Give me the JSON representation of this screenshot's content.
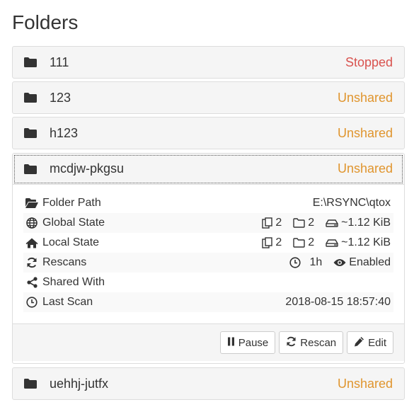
{
  "page": {
    "title": "Folders"
  },
  "colors": {
    "stopped": "#d9534f",
    "unshared": "#e0952e"
  },
  "folders": [
    {
      "name": "111",
      "status": "Stopped"
    },
    {
      "name": "123",
      "status": "Unshared"
    },
    {
      "name": "h123",
      "status": "Unshared"
    },
    {
      "name": "mcdjw-pkgsu",
      "status": "Unshared"
    },
    {
      "name": "uehhj-jutfx",
      "status": "Unshared"
    }
  ],
  "details": {
    "folder_path": {
      "label": "Folder Path",
      "value": "E:\\RSYNC\\qtox",
      "icon": "folder-open-icon"
    },
    "global_state": {
      "label": "Global State",
      "files": "2",
      "dirs": "2",
      "size": "~1.12 KiB",
      "icon": "globe-icon"
    },
    "local_state": {
      "label": "Local State",
      "files": "2",
      "dirs": "2",
      "size": "~1.12 KiB",
      "icon": "home-icon"
    },
    "rescans": {
      "label": "Rescans",
      "interval": "1h",
      "watch": "Enabled",
      "icon": "refresh-icon"
    },
    "shared_with": {
      "label": "Shared With",
      "value": "",
      "icon": "share-icon"
    },
    "last_scan": {
      "label": "Last Scan",
      "value": "2018-08-15 18:57:40",
      "icon": "clock-icon"
    }
  },
  "actions": {
    "pause": "Pause",
    "rescan": "Rescan",
    "edit": "Edit"
  }
}
